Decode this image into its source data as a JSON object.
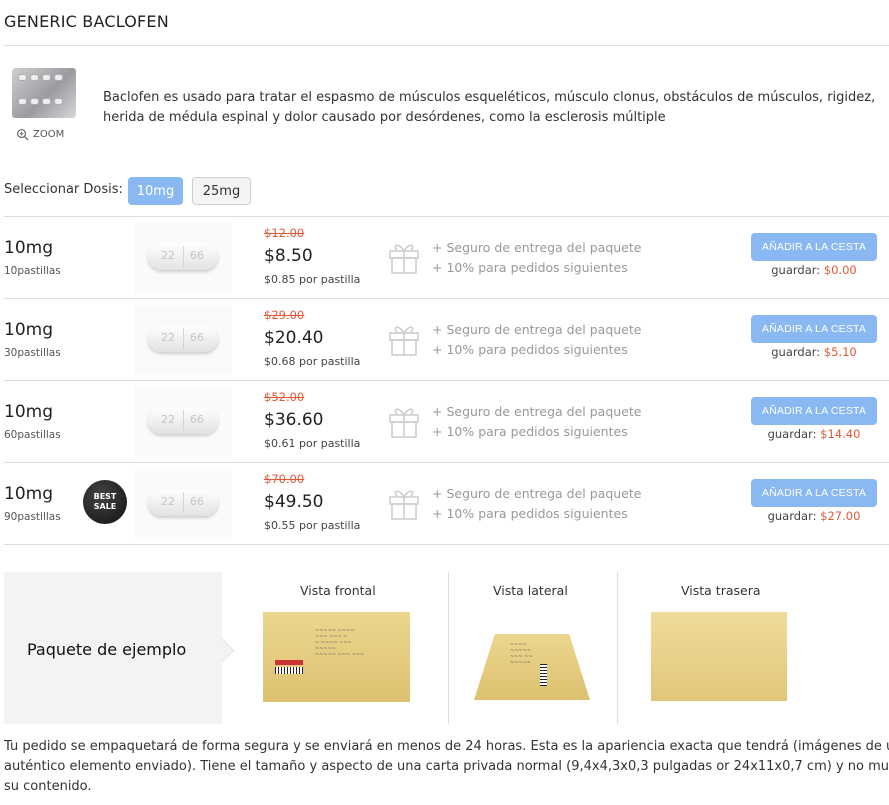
{
  "page": {
    "title": "GENERIC BACLOFEN"
  },
  "product": {
    "zoom_label": "ZOOM",
    "description": "Baclofen es usado para tratar el espasmo de músculos esqueléticos, músculo clonus, obstáculos de músculos, rigidez, herida de médula espinal y dolor causado por desórdenes, como la esclerosis múltiple"
  },
  "dose_selector": {
    "label": "Seleccionar Dosis:",
    "options": [
      "10mg",
      "25mg"
    ],
    "selected": "10mg"
  },
  "pill_imprint": {
    "left": "22",
    "right": "66"
  },
  "offers": [
    {
      "dose": "10mg",
      "count": "10pastillas",
      "old_price": "$12.00",
      "price": "$8.50",
      "per_pill": "$0.85 por pastilla",
      "perk1": "+ Seguro de entrega del paquete",
      "perk2": "+ 10% para pedidos siguientes",
      "button": "AÑADIR A LA CESTA",
      "save_label": "guardar:",
      "save_amount": "$0.00"
    },
    {
      "dose": "10mg",
      "count": "30pastillas",
      "old_price": "$29.00",
      "price": "$20.40",
      "per_pill": "$0.68 por pastilla",
      "perk1": "+ Seguro de entrega del paquete",
      "perk2": "+ 10% para pedidos siguientes",
      "button": "AÑADIR A LA CESTA",
      "save_label": "guardar:",
      "save_amount": "$5.10"
    },
    {
      "dose": "10mg",
      "count": "60pastillas",
      "old_price": "$52.00",
      "price": "$36.60",
      "per_pill": "$0.61 por pastilla",
      "perk1": "+ Seguro de entrega del paquete",
      "perk2": "+ 10% para pedidos siguientes",
      "button": "AÑADIR A LA CESTA",
      "save_label": "guardar:",
      "save_amount": "$14.40"
    },
    {
      "dose": "10mg",
      "count": "90pastillas",
      "old_price": "$70.00",
      "price": "$49.50",
      "per_pill": "$0.55 por pastilla",
      "perk1": "+ Seguro de entrega del paquete",
      "perk2": "+ 10% para pedidos siguientes",
      "button": "AÑADIR A LA CESTA",
      "save_label": "guardar:",
      "save_amount": "$27.00",
      "badge_line1": "BEST",
      "badge_line2": "SALE"
    }
  ],
  "package": {
    "title": "Paquete de ejemplo",
    "views": [
      "Vista frontal",
      "Vista lateral",
      "Vista trasera"
    ]
  },
  "footer_text": {
    "line1": "Tu pedido se empaquetará de forma segura y se enviará en menos de 24 horas. Esta es la apariencia exacta que tendrá (imágenes de un",
    "line2": "auténtico elemento enviado). Tiene el tamaño y aspecto de una carta privada normal (9,4x4,3x0,3 pulgadas or 24x11x0,7 cm) y no muestra",
    "line3": "su contenido."
  },
  "colors": {
    "accent": "#8ab8f3",
    "sale_red": "#e05a3a",
    "muted": "#999999"
  }
}
